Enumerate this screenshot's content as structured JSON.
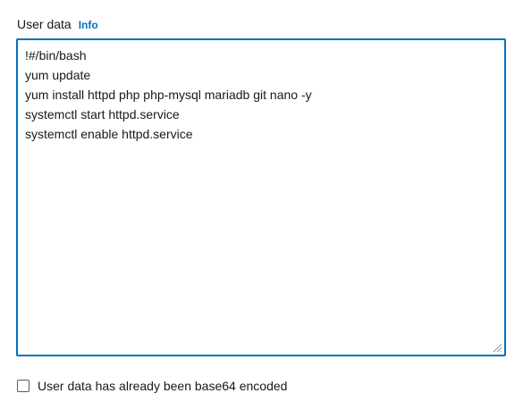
{
  "user_data": {
    "label": "User data",
    "info_link": "Info",
    "script": "!#/bin/bash\nyum update\nyum install httpd php php-mysql mariadb git nano -y\nsystemctl start httpd.service\nsystemctl enable httpd.service"
  },
  "base64_checkbox": {
    "label": "User data has already been base64 encoded",
    "checked": false
  },
  "colors": {
    "accent": "#0073bb",
    "text": "#16191f"
  }
}
